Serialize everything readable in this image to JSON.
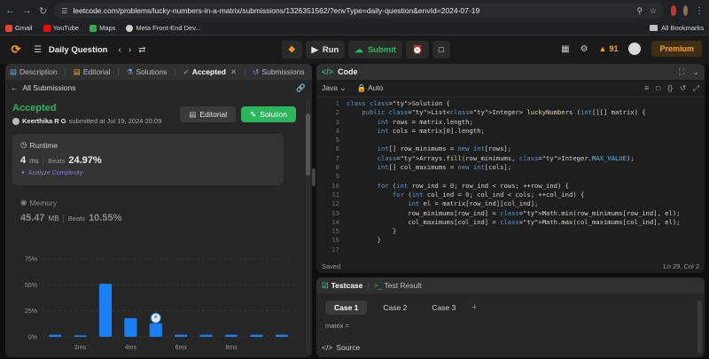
{
  "browser": {
    "url": "leetcode.com/problems/lucky-numbers-in-a-matrix/submissions/1326351562/?envType=daily-question&envId=2024-07-19",
    "bookmarks": [
      {
        "label": "Gmail",
        "color": "#ea4335"
      },
      {
        "label": "YouTube",
        "color": "#ff0000"
      },
      {
        "label": "Maps",
        "color": "#34a853"
      },
      {
        "label": "Meta Front-End Dev...",
        "color": "#d0d0d0"
      }
    ],
    "all_bookmarks": "All Bookmarks"
  },
  "topnav": {
    "title": "Daily Question",
    "run_label": "Run",
    "submit_label": "Submit",
    "streak": "91",
    "premium_label": "Premium"
  },
  "left": {
    "tabs": [
      {
        "label": "Description"
      },
      {
        "label": "Editorial"
      },
      {
        "label": "Solutions"
      },
      {
        "label": "Accepted"
      },
      {
        "label": "Submissions"
      }
    ],
    "all_submissions": "All Submissions",
    "status": "Accepted",
    "author": "Keerthika R G",
    "submitted_text": "submitted at Jul 19, 2024 20:09",
    "editorial_btn": "Editorial",
    "solution_btn": "Solution",
    "runtime": {
      "label": "Runtime",
      "value": "4",
      "unit": "ms",
      "beats_label": "Beats",
      "beats": "24.97%",
      "analyze": "Analyze Complexity"
    },
    "memory": {
      "label": "Memory",
      "value": "45.47",
      "unit": "MB",
      "beats_label": "Beats",
      "beats": "10.55%"
    }
  },
  "chart_data": {
    "type": "bar",
    "ytick_labels": [
      "75%",
      "50%",
      "25%",
      "0%"
    ],
    "ylim": [
      0,
      75
    ],
    "xtick_labels": [
      "2ms",
      "4ms",
      "6ms",
      "8ms"
    ],
    "values": [
      2,
      1.5,
      51,
      18,
      13,
      2,
      2,
      2,
      2,
      2
    ],
    "highlight_index": 4,
    "bar_color": "#1a7ff0"
  },
  "code": {
    "title": "Code",
    "language": "Java",
    "auto_label": "Auto",
    "saved": "Saved",
    "cursor": "Ln 29, Col 2",
    "lines": [
      {
        "n": "1",
        "t": "class Solution {"
      },
      {
        "n": "2",
        "t": "    public List<Integer> luckyNumbers (int[][] matrix) {"
      },
      {
        "n": "3",
        "t": "        int rows = matrix.length;"
      },
      {
        "n": "4",
        "t": "        int cols = matrix[0].length;"
      },
      {
        "n": "5",
        "t": ""
      },
      {
        "n": "6",
        "t": "        int[] row_minimums = new int[rows];"
      },
      {
        "n": "7",
        "t": "        Arrays.fill(row_minimums, Integer.MAX_VALUE);"
      },
      {
        "n": "8",
        "t": "        int[] col_maximums = new int[cols];"
      },
      {
        "n": "9",
        "t": ""
      },
      {
        "n": "10",
        "t": "        for (int row_ind = 0; row_ind < rows; ++row_ind) {"
      },
      {
        "n": "11",
        "t": "            for (int col_ind = 0; col_ind < cols; ++col_ind) {"
      },
      {
        "n": "12",
        "t": "                int el = matrix[row_ind][col_ind];"
      },
      {
        "n": "13",
        "t": "                row_minimums[row_ind] = Math.min(row_minimums[row_ind], el);"
      },
      {
        "n": "14",
        "t": "                col_maximums[col_ind] = Math.max(col_maximums[col_ind], el);"
      },
      {
        "n": "15",
        "t": "            }"
      },
      {
        "n": "16",
        "t": "        }"
      },
      {
        "n": "17",
        "t": ""
      }
    ]
  },
  "testcase": {
    "tab_label": "Testcase",
    "result_label": "Test Result",
    "cases": [
      "Case 1",
      "Case 2",
      "Case 3"
    ],
    "matrix_label": "matrix =",
    "source_label": "Source"
  }
}
